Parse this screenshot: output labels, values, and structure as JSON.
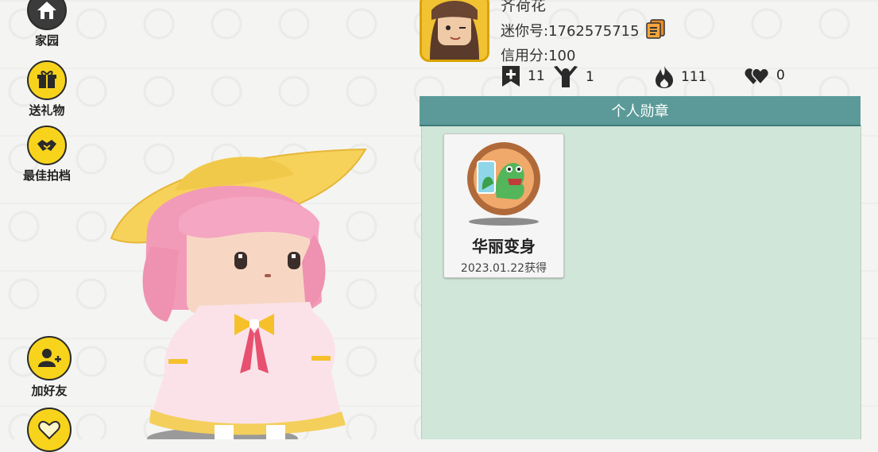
{
  "sidebar": {
    "home_label": "家园",
    "gift_label": "送礼物",
    "partner_label": "最佳拍档",
    "add_friend_label": "加好友"
  },
  "profile": {
    "name": "齐荷花",
    "mini_id": "迷你号:1762575715",
    "credit": "信用分:100",
    "stats": {
      "favorites": "11",
      "fans": "1",
      "popularity": "111",
      "likes": "0"
    }
  },
  "medal_panel": {
    "title": "个人勋章",
    "medals": [
      {
        "name": "华丽变身",
        "date": "2023.01.22获得"
      }
    ]
  },
  "colors": {
    "accent_yellow": "#f7d31c",
    "panel_header": "#5b9a98",
    "panel_body": "#cfe6d9"
  }
}
